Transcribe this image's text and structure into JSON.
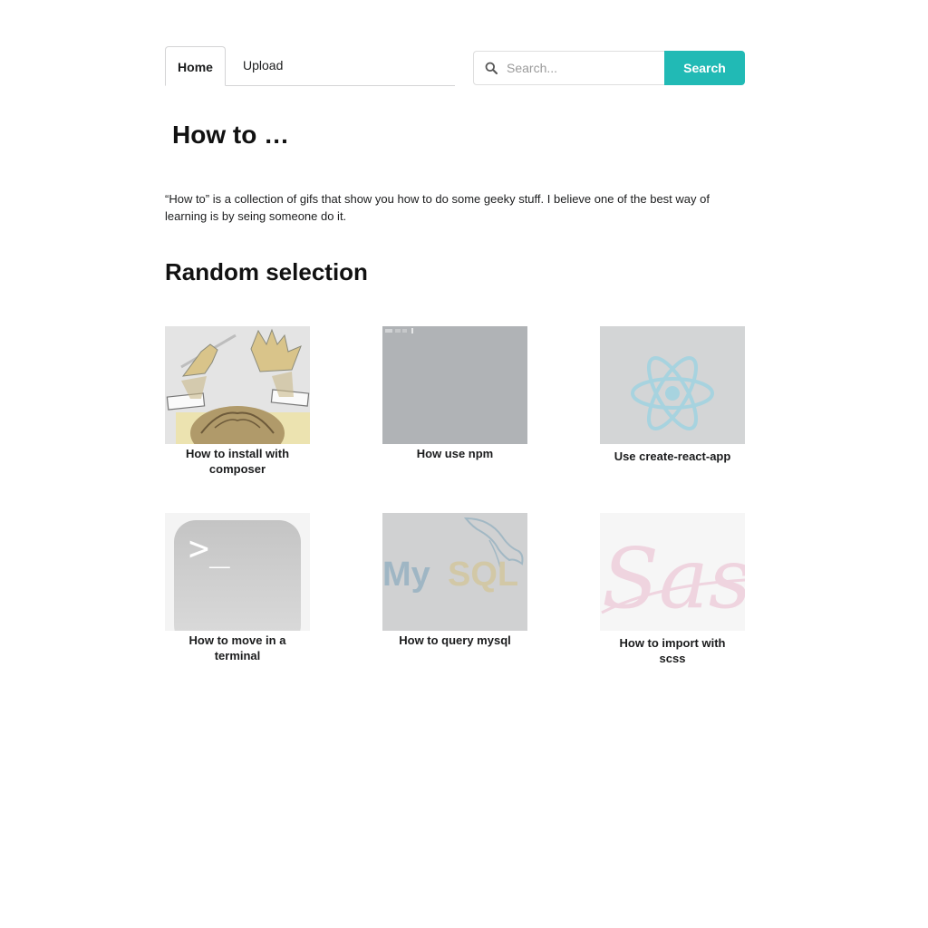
{
  "nav": {
    "tabs": [
      {
        "label": "Home",
        "active": true
      },
      {
        "label": "Upload",
        "active": false
      }
    ]
  },
  "search": {
    "placeholder": "Search...",
    "value": "",
    "button_label": "Search",
    "icon": "search-icon"
  },
  "page": {
    "title": "How to …",
    "intro": "“How to” is a collection of gifs that show you how to do some geeky stuff. I believe one of the best way of learning is by seing someone do it.",
    "section_title": "Random selection"
  },
  "cards": [
    {
      "label": "How to install with composer",
      "thumbnail": "composer-logo"
    },
    {
      "label": "How use npm",
      "thumbnail": "terminal-recording"
    },
    {
      "label": "Use create-react-app",
      "thumbnail": "react-logo"
    },
    {
      "label": "How to move in a terminal",
      "thumbnail": "terminal-app-icon"
    },
    {
      "label": "How to query mysql",
      "thumbnail": "mysql-logo"
    },
    {
      "label": "How to import with scss",
      "thumbnail": "sass-logo"
    }
  ],
  "colors": {
    "accent": "#21bab5",
    "border": "#d4d4d5",
    "text": "#1b1c1d"
  }
}
